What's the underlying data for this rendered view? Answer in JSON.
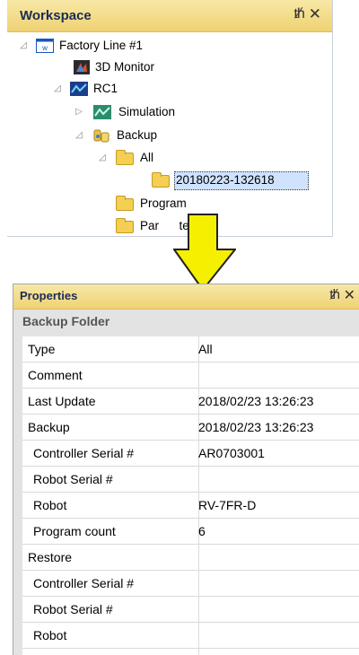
{
  "workspace": {
    "title": "Workspace",
    "tree": {
      "factory_line": "Factory Line #1",
      "monitor": "3D Monitor",
      "rc1": "RC1",
      "simulation": "Simulation",
      "backup": "Backup",
      "all": "All",
      "selected_item": "20180223-132618",
      "program": "Program",
      "parameter": "Par      ter"
    }
  },
  "properties": {
    "title": "Properties",
    "category": "Backup Folder",
    "rows": [
      {
        "name": "Type",
        "value": "All"
      },
      {
        "name": "Comment",
        "value": ""
      },
      {
        "name": "Last Update",
        "value": "2018/02/23 13:26:23"
      },
      {
        "name": "Backup",
        "value": "2018/02/23 13:26:23"
      },
      {
        "name": "Controller Serial #",
        "value": "AR0703001"
      },
      {
        "name": "Robot Serial #",
        "value": ""
      },
      {
        "name": "Robot",
        "value": "RV-7FR-D"
      },
      {
        "name": "Program count",
        "value": "6"
      },
      {
        "name": "Restore",
        "value": ""
      },
      {
        "name": "Controller Serial #",
        "value": ""
      },
      {
        "name": "Robot Serial #",
        "value": ""
      },
      {
        "name": "Robot",
        "value": ""
      }
    ]
  },
  "icons": {
    "pin": "pin-icon",
    "close": "close-icon",
    "folder": "folder-icon",
    "arrow": "down-arrow-icon"
  },
  "colors": {
    "header": "#efd273",
    "arrow_fill": "#f5f000",
    "selection": "#cfe3ff"
  }
}
